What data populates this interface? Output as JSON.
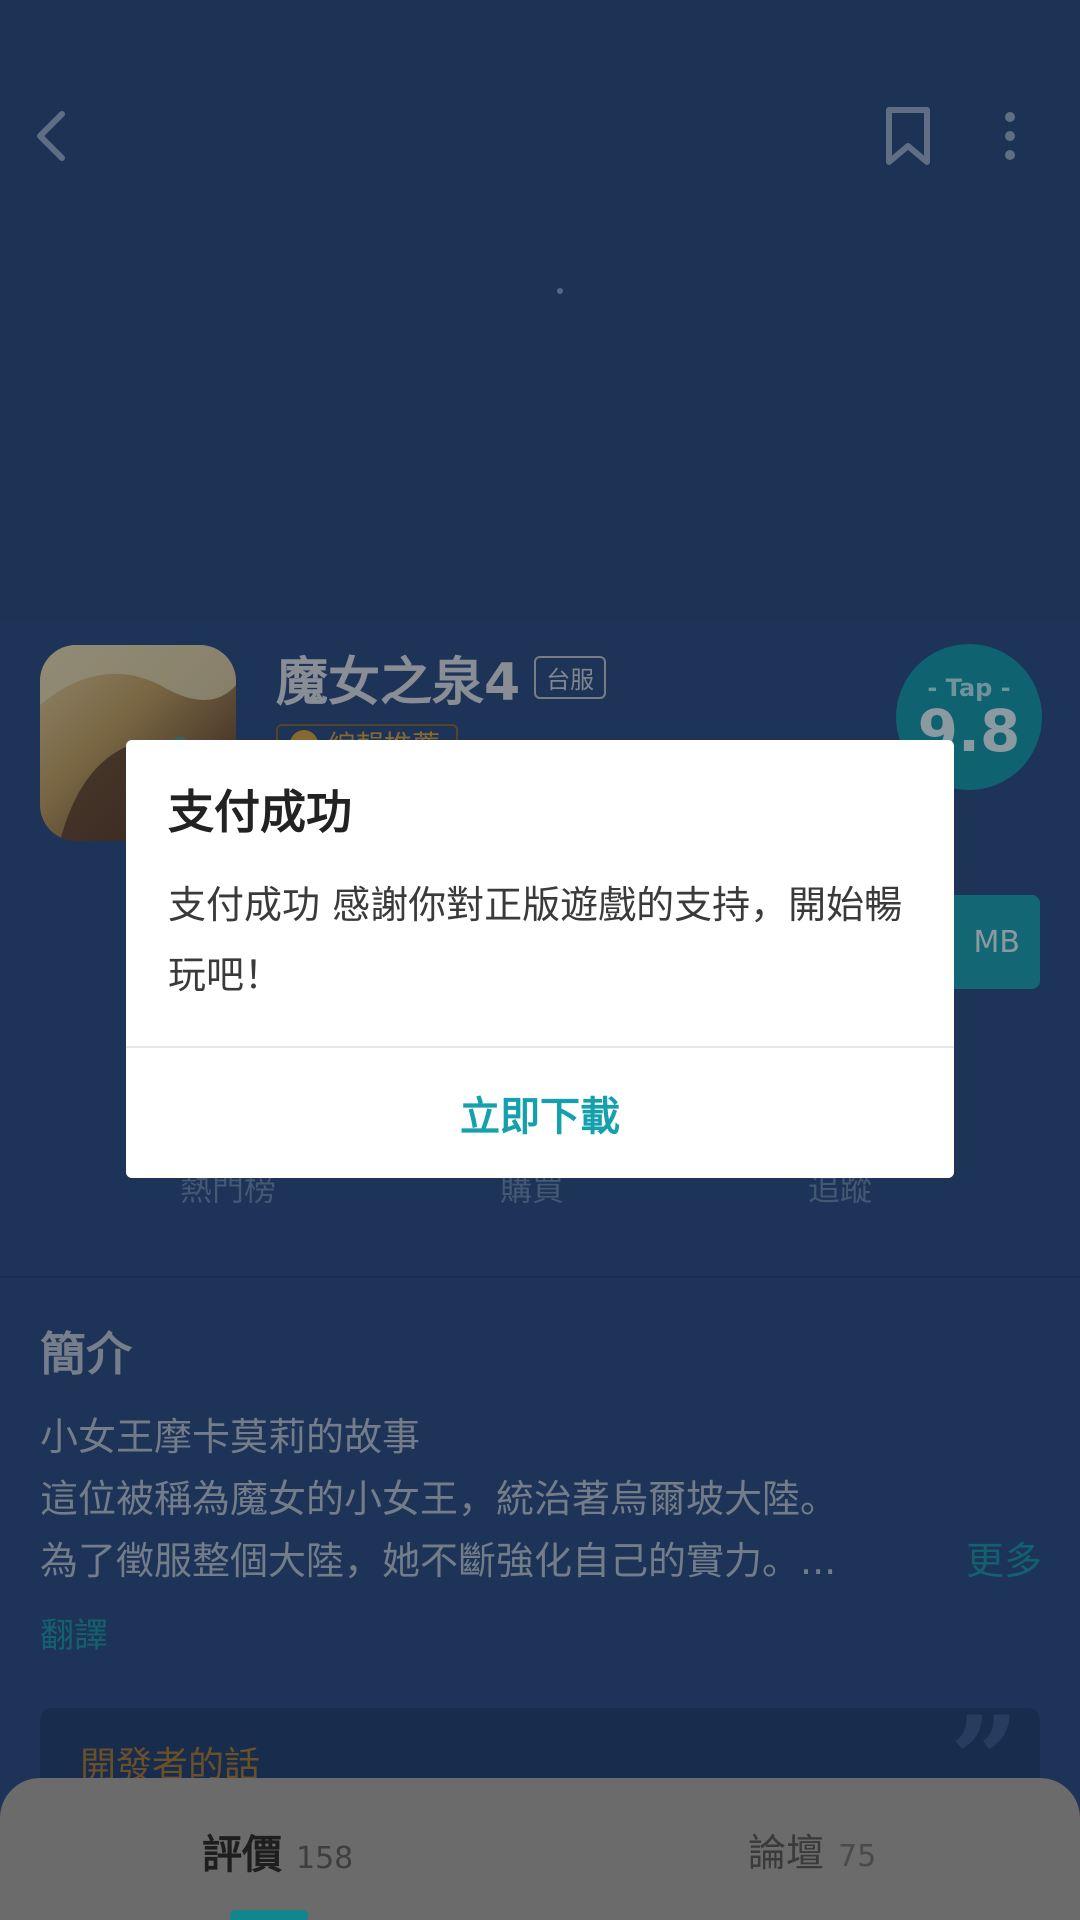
{
  "app": {
    "title": "魔女之泉4",
    "region_tag": "台服",
    "badge": "編輯推薦",
    "score_label": "- Tap -",
    "score": "9.8",
    "download_suffix": "MB"
  },
  "stats": {
    "labels": [
      "熱門榜",
      "購買",
      "追蹤"
    ]
  },
  "intro": {
    "title": "簡介",
    "lines": [
      "小女王摩卡莫莉的故事",
      "這位被稱為魔女的小女王，統治著烏爾坡大陸。",
      "為了徵服整個大陸，她不斷強化自己的實力。..."
    ],
    "more": "更多",
    "translate": "翻譯"
  },
  "developer": {
    "title": "開發者的話",
    "quote": "”"
  },
  "tabs": [
    {
      "label": "評價",
      "count": "158"
    },
    {
      "label": "論壇",
      "count": "75"
    }
  ],
  "dialog": {
    "title": "支付成功",
    "message": "支付成功 感謝你對正版遊戲的支持，開始暢玩吧！",
    "action": "立即下載"
  },
  "colors": {
    "accent": "#14a0ad",
    "background": "#2b4b7c",
    "badge": "#e0a83a"
  },
  "icons": {
    "back": "back-icon",
    "bookmark": "bookmark-icon",
    "more": "more-vertical-icon"
  }
}
